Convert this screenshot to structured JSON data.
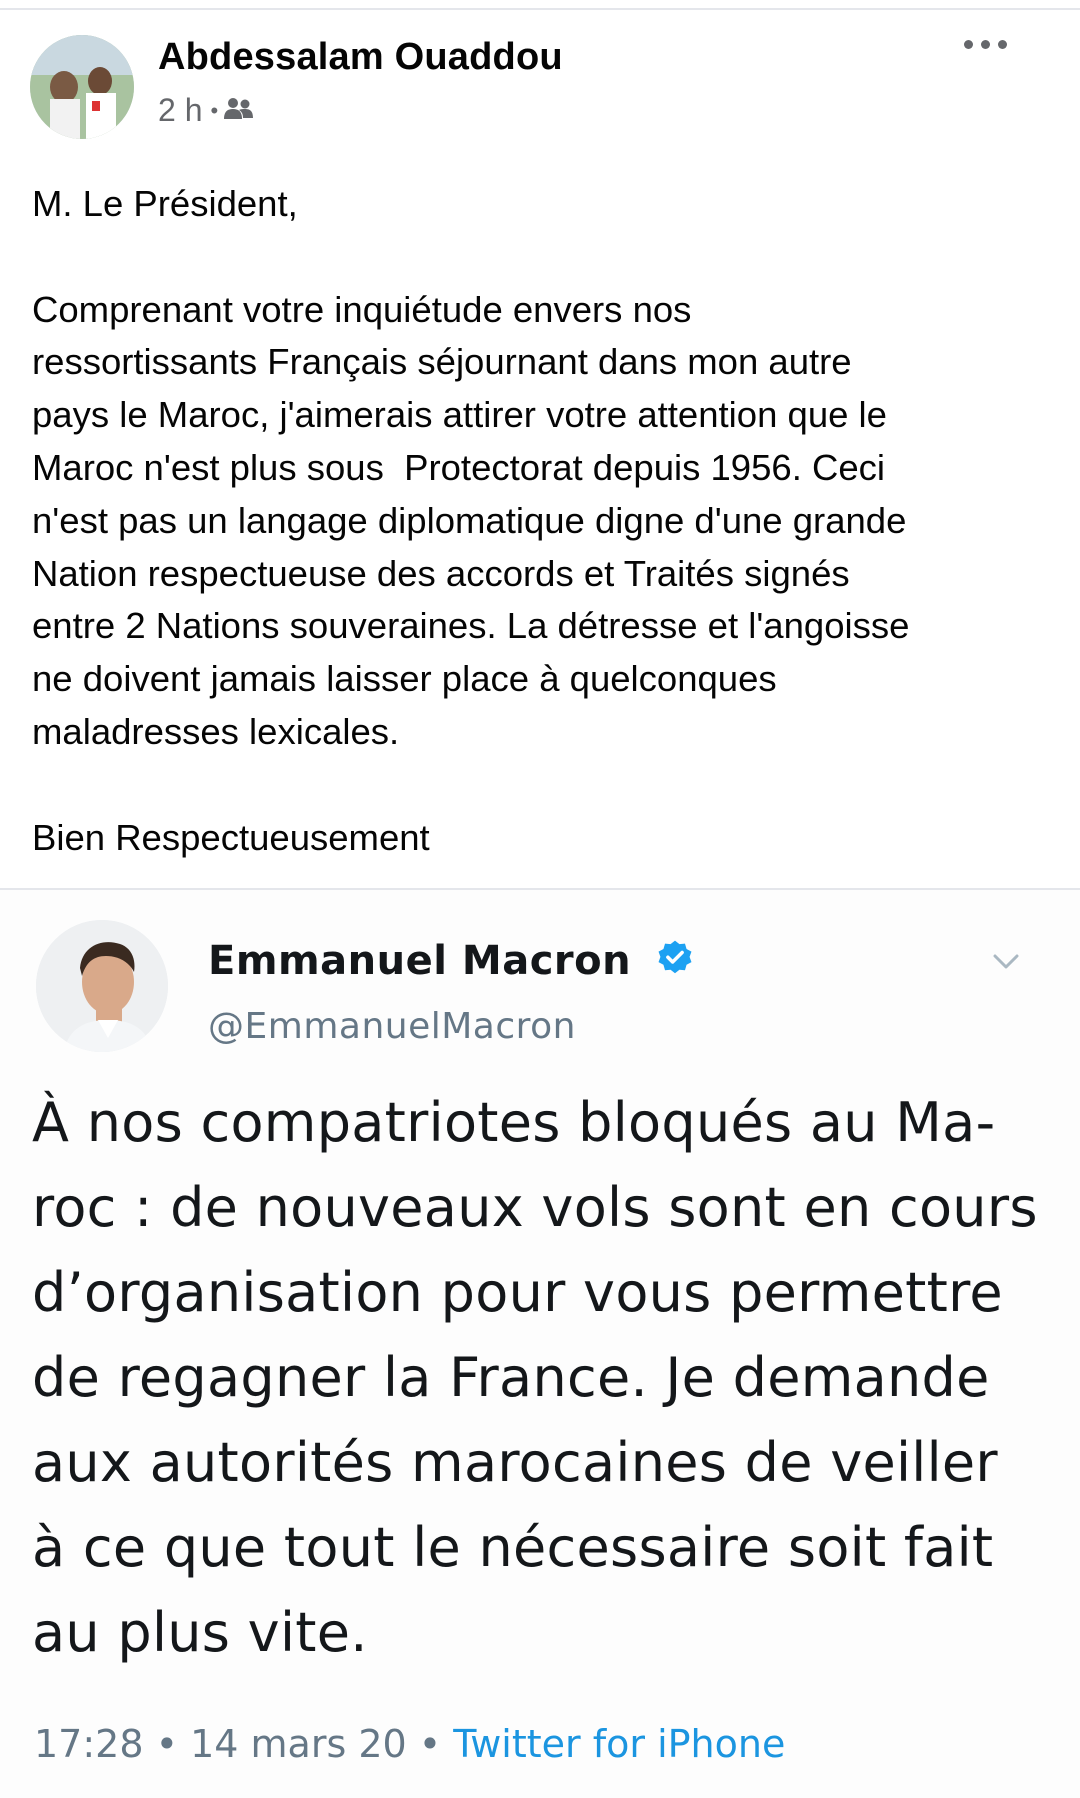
{
  "post": {
    "author_name": "Abdessalam Ouaddou",
    "time": "2 h",
    "audience_icon": "friends-icon",
    "more_icon": "more-options-icon",
    "text": {
      "salutation": "M. Le Président,",
      "body_lines": [
        "Comprenant votre inquiétude envers nos",
        "ressortissants Français séjournant dans mon autre",
        "pays le Maroc, j'aimerais attirer votre attention que le",
        "Maroc n'est plus sous  Protectorat depuis 1956. Ceci",
        "n'est pas un langage diplomatique digne d'une grande",
        "Nation respectueuse des accords et Traités signés",
        "entre 2 Nations souveraines. La détresse et l'angoisse",
        "ne doivent jamais laisser place à quelconques",
        "maladresses lexicales."
      ],
      "closing": "Bien Respectueusement"
    }
  },
  "tweet": {
    "name": "Emmanuel Macron",
    "verified_icon": "verified-badge-icon",
    "handle": "@EmmanuelMacron",
    "chevron_icon": "chevron-down-icon",
    "lines": [
      "À nos compatriotes bloqués au Ma-",
      "roc : de nouveaux vols sont en cours",
      "d’organisation pour vous permettre",
      "de regagner la France. Je demande",
      "aux autorités marocaines de veiller",
      "à ce que tout le nécessaire soit fait",
      "au plus vite."
    ],
    "time": "17:28",
    "date": "14 mars 20",
    "source": "Twitter for iPhone"
  },
  "colors": {
    "primary_text": "#050505",
    "secondary_text": "#65676b",
    "twitter_blue": "#1b95e0",
    "divider": "#e4e6eb"
  }
}
